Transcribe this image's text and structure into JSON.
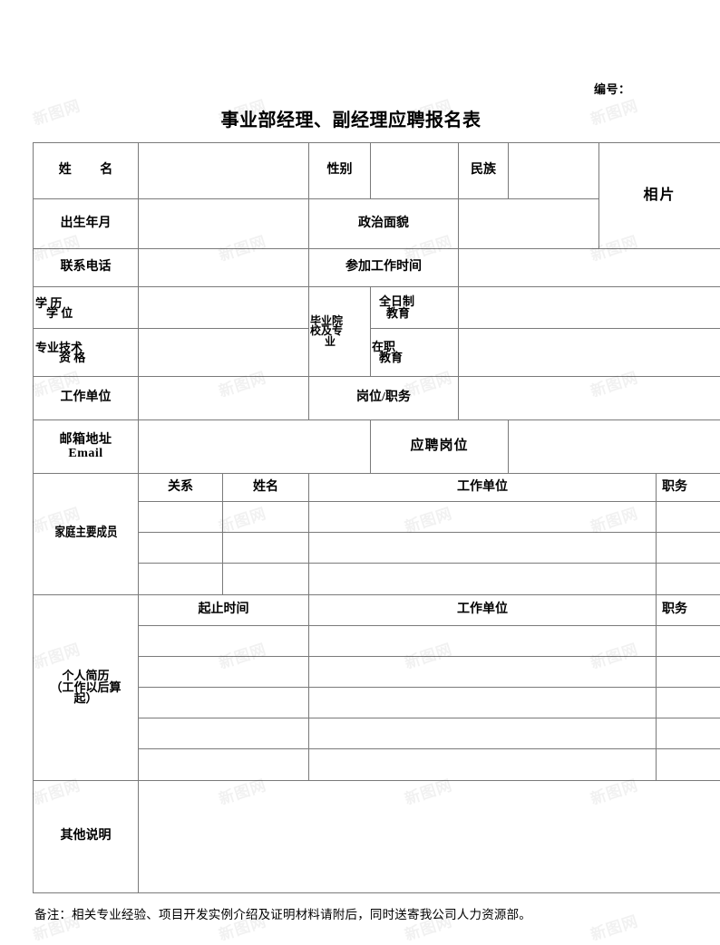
{
  "header": {
    "doc_number_label": "编号：",
    "title": "事业部经理、副经理应聘报名表"
  },
  "fields": {
    "name": "姓 名",
    "gender": "性别",
    "ethnicity": "民族",
    "photo": "相片",
    "birth_date": "出生年月",
    "political_status": "政治面貌",
    "phone": "联系电话",
    "work_start_time": "参加工作时间",
    "education_line1": "学 历",
    "education_line2": "学 位",
    "school_major_line1": "毕业院",
    "school_major_line2": "校及专",
    "school_major_line3": "业",
    "fulltime_edu_line1": "全日制",
    "fulltime_edu_line2": "教育",
    "professional_title_line1": "专业技术",
    "professional_title_line2": "资 格",
    "inservice_edu_line1": "在职",
    "inservice_edu_line2": "教育",
    "work_unit": "工作单位",
    "position_duty": "岗位/职务",
    "email_line1": "邮箱地址",
    "email_line2": "Email",
    "applied_position": "应聘岗位"
  },
  "family": {
    "section_label": "家庭主要成员",
    "columns": [
      "关系",
      "姓名",
      "工作单位",
      "职务"
    ],
    "rows": [
      [
        "",
        "",
        "",
        ""
      ],
      [
        "",
        "",
        "",
        ""
      ],
      [
        "",
        "",
        "",
        ""
      ]
    ]
  },
  "resume": {
    "section_label_line1": "个人简历",
    "section_label_line2": "（工作以后算",
    "section_label_line3": "起）",
    "columns": [
      "起止时间",
      "工作单位",
      "职务"
    ],
    "rows": [
      [
        "",
        "",
        ""
      ],
      [
        "",
        "",
        ""
      ],
      [
        "",
        "",
        ""
      ],
      [
        "",
        "",
        ""
      ],
      [
        "",
        "",
        ""
      ]
    ]
  },
  "other": {
    "label": "其他说明",
    "value": ""
  },
  "footer": {
    "note": "备注：相关专业经验、项目开发实例介绍及证明材料请附后，同时送寄我公司人力资源部。"
  },
  "watermark": {
    "text": "新图网"
  },
  "values": {
    "name": "",
    "gender": "",
    "ethnicity": "",
    "birth_date": "",
    "political_status": "",
    "phone": "",
    "work_start_time": "",
    "education": "",
    "fulltime_edu": "",
    "professional_title": "",
    "inservice_edu": "",
    "work_unit": "",
    "position_duty": "",
    "email": "",
    "applied_position": "",
    "doc_number": ""
  }
}
